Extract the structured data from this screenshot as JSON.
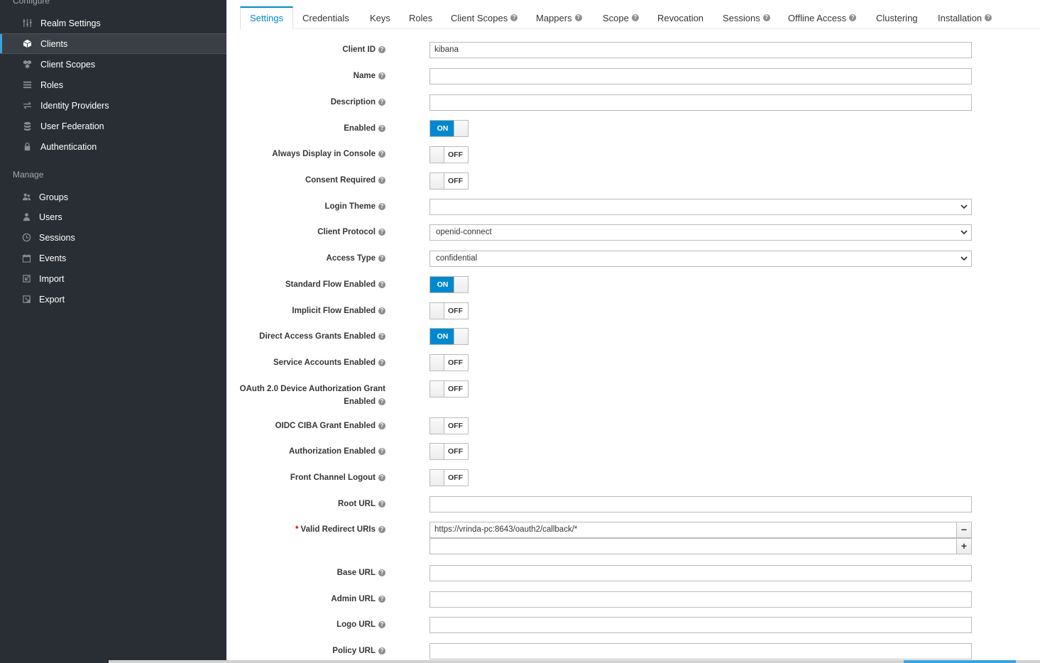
{
  "sidebar": {
    "configure_title": "Configure",
    "configure_items": [
      {
        "label": "Realm Settings",
        "icon": "sliders-icon"
      },
      {
        "label": "Clients",
        "icon": "cube-icon",
        "active": true
      },
      {
        "label": "Client Scopes",
        "icon": "cubes-icon"
      },
      {
        "label": "Roles",
        "icon": "list-icon"
      },
      {
        "label": "Identity Providers",
        "icon": "exchange-icon"
      },
      {
        "label": "User Federation",
        "icon": "database-icon"
      },
      {
        "label": "Authentication",
        "icon": "lock-icon"
      }
    ],
    "manage_title": "Manage",
    "manage_items": [
      {
        "label": "Groups",
        "icon": "users-icon"
      },
      {
        "label": "Users",
        "icon": "user-icon"
      },
      {
        "label": "Sessions",
        "icon": "clock-icon"
      },
      {
        "label": "Events",
        "icon": "calendar-icon"
      },
      {
        "label": "Import",
        "icon": "import-icon"
      },
      {
        "label": "Export",
        "icon": "export-icon"
      }
    ]
  },
  "tabs": [
    {
      "label": "Settings",
      "help": false,
      "active": true
    },
    {
      "label": "Credentials",
      "help": false
    },
    {
      "label": "Keys",
      "help": false
    },
    {
      "label": "Roles",
      "help": false
    },
    {
      "label": "Client Scopes",
      "help": true
    },
    {
      "label": "Mappers",
      "help": true
    },
    {
      "label": "Scope",
      "help": true
    },
    {
      "label": "Revocation",
      "help": false
    },
    {
      "label": "Sessions",
      "help": true
    },
    {
      "label": "Offline Access",
      "help": true
    },
    {
      "label": "Clustering",
      "help": false
    },
    {
      "label": "Installation",
      "help": true
    }
  ],
  "form": {
    "client_id": {
      "label": "Client ID",
      "value": "kibana"
    },
    "name": {
      "label": "Name",
      "value": ""
    },
    "description": {
      "label": "Description",
      "value": ""
    },
    "enabled": {
      "label": "Enabled",
      "state": "ON"
    },
    "always_display": {
      "label": "Always Display in Console",
      "state": "OFF"
    },
    "consent_required": {
      "label": "Consent Required",
      "state": "OFF"
    },
    "login_theme": {
      "label": "Login Theme",
      "value": ""
    },
    "client_protocol": {
      "label": "Client Protocol",
      "value": "openid-connect"
    },
    "access_type": {
      "label": "Access Type",
      "value": "confidential"
    },
    "standard_flow": {
      "label": "Standard Flow Enabled",
      "state": "ON"
    },
    "implicit_flow": {
      "label": "Implicit Flow Enabled",
      "state": "OFF"
    },
    "direct_access": {
      "label": "Direct Access Grants Enabled",
      "state": "ON"
    },
    "service_accounts": {
      "label": "Service Accounts Enabled",
      "state": "OFF"
    },
    "device_auth_line1": "OAuth 2.0 Device Authorization Grant",
    "device_auth_line2": "Enabled",
    "device_auth_state": "OFF",
    "ciba": {
      "label": "OIDC CIBA Grant Enabled",
      "state": "OFF"
    },
    "authorization": {
      "label": "Authorization Enabled",
      "state": "OFF"
    },
    "front_channel": {
      "label": "Front Channel Logout",
      "state": "OFF"
    },
    "root_url": {
      "label": "Root URL",
      "value": ""
    },
    "redirect_uris": {
      "label": "Valid Redirect URIs",
      "required_mark": "*",
      "value": "https://vrinda-pc:8643/oauth2/callback/*",
      "new_value": "",
      "remove": "−",
      "add": "+"
    },
    "base_url": {
      "label": "Base URL",
      "value": ""
    },
    "admin_url": {
      "label": "Admin URL",
      "value": ""
    },
    "logo_url": {
      "label": "Logo URL",
      "value": ""
    },
    "policy_url": {
      "label": "Policy URL",
      "value": ""
    }
  },
  "colors": {
    "accent": "#0088ce",
    "sidebar_bg": "#292e34",
    "active_bar": "#39a5dc"
  }
}
